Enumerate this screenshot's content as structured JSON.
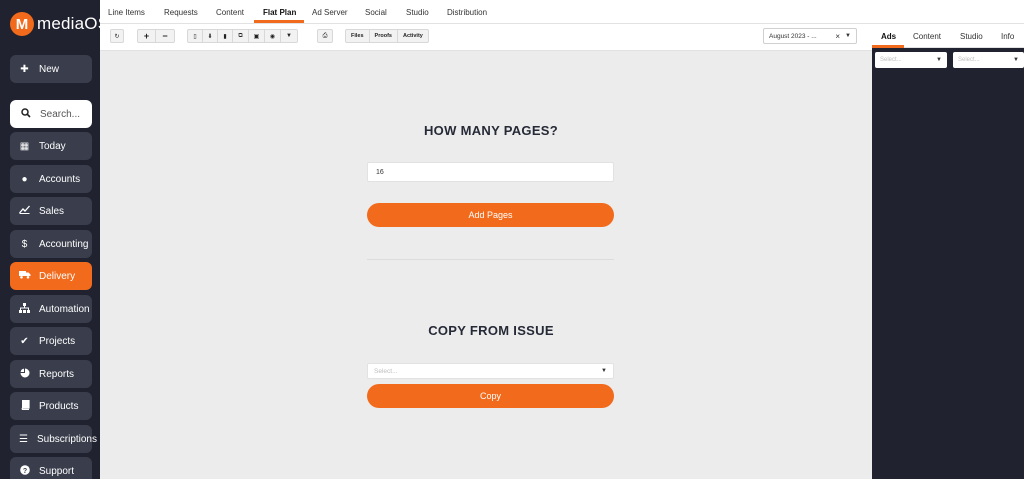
{
  "app": {
    "logo_letter": "M",
    "logo_text": "mediaOS",
    "accent_color": "#f26a1b",
    "sidebar_color": "#20232f"
  },
  "sidebar": {
    "new_button": {
      "label": "New",
      "icon": "plus-icon"
    },
    "search": {
      "placeholder": "Search...",
      "icon": "search-icon"
    },
    "items": [
      {
        "label": "Today",
        "icon": "calendar-icon",
        "active": false
      },
      {
        "label": "Accounts",
        "icon": "users-icon",
        "active": false
      },
      {
        "label": "Sales",
        "icon": "chart-line-icon",
        "active": false
      },
      {
        "label": "Accounting",
        "icon": "dollar-icon",
        "active": false
      },
      {
        "label": "Delivery",
        "icon": "truck-icon",
        "active": true
      },
      {
        "label": "Automation",
        "icon": "sitemap-icon",
        "active": false
      },
      {
        "label": "Projects",
        "icon": "check-icon",
        "active": false
      },
      {
        "label": "Reports",
        "icon": "pie-chart-icon",
        "active": false
      },
      {
        "label": "Products",
        "icon": "book-icon",
        "active": false
      },
      {
        "label": "Subscriptions",
        "icon": "list-icon",
        "active": false
      },
      {
        "label": "Support",
        "icon": "question-icon",
        "active": false
      }
    ]
  },
  "topnav": {
    "tabs": [
      "Line Items",
      "Requests",
      "Content",
      "Flat Plan",
      "Ad Server",
      "Social",
      "Studio",
      "Distribution"
    ],
    "active_tab": "Flat Plan"
  },
  "toolbar": {
    "files_label": "Files",
    "proofs_label": "Proofs",
    "activity_label": "Activity",
    "issue_value": "August 2023 - ..."
  },
  "main": {
    "pages_heading": "HOW MANY PAGES?",
    "pages_value": "16",
    "add_pages_label": "Add Pages",
    "copy_heading": "COPY FROM ISSUE",
    "copy_select_placeholder": "Select...",
    "copy_label": "Copy"
  },
  "right_panel": {
    "tabs": [
      "Ads",
      "Content",
      "Studio",
      "Info"
    ],
    "active_tab": "Ads",
    "select1_placeholder": "Select...",
    "select2_placeholder": "Select..."
  }
}
